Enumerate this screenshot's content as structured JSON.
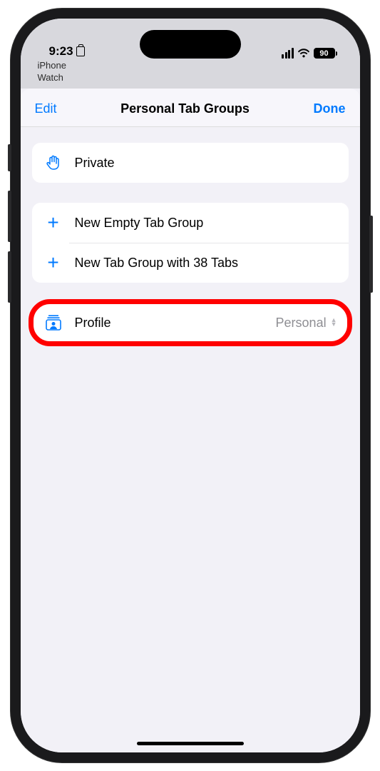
{
  "status": {
    "time": "9:23",
    "battery": "90",
    "bg_line1": "iPhone",
    "bg_line2": "Watch"
  },
  "header": {
    "edit": "Edit",
    "title": "Personal Tab Groups",
    "done": "Done"
  },
  "private_row": {
    "label": "Private"
  },
  "actions": {
    "new_empty": "New Empty Tab Group",
    "new_with_tabs": "New Tab Group with 38 Tabs"
  },
  "profile": {
    "label": "Profile",
    "value": "Personal"
  }
}
